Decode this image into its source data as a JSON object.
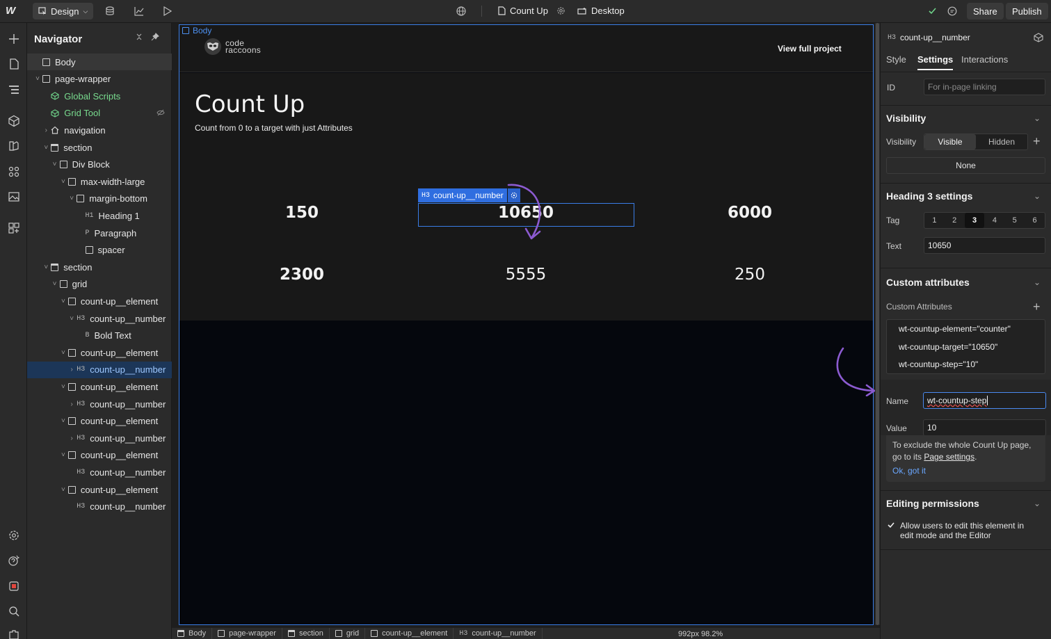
{
  "topbar": {
    "logo": "W",
    "mode": "Design",
    "page": "Count Up",
    "breakpoint": "Desktop",
    "share": "Share",
    "publish": "Publish"
  },
  "navigator": {
    "title": "Navigator",
    "items": [
      {
        "label": "Body",
        "kind": "el",
        "indent": 0,
        "caret": ""
      },
      {
        "label": "page-wrapper",
        "kind": "el",
        "indent": 0,
        "caret": "v"
      },
      {
        "label": "Global Scripts",
        "kind": "comp",
        "indent": 1,
        "caret": ""
      },
      {
        "label": "Grid Tool",
        "kind": "comp",
        "indent": 1,
        "caret": ""
      },
      {
        "label": "navigation",
        "kind": "home",
        "indent": 1,
        "caret": ">"
      },
      {
        "label": "section",
        "kind": "sec",
        "indent": 1,
        "caret": "v"
      },
      {
        "label": "Div Block",
        "kind": "el",
        "indent": 2,
        "caret": "v"
      },
      {
        "label": "max-width-large",
        "kind": "el",
        "indent": 3,
        "caret": "v"
      },
      {
        "label": "margin-bottom",
        "kind": "el",
        "indent": 4,
        "caret": "v"
      },
      {
        "label": "Heading 1",
        "kind": "tag",
        "tag": "H1",
        "indent": 5,
        "caret": ""
      },
      {
        "label": "Paragraph",
        "kind": "tag",
        "tag": "P",
        "indent": 5,
        "caret": ""
      },
      {
        "label": "spacer",
        "kind": "el",
        "indent": 5,
        "caret": ""
      },
      {
        "label": "section",
        "kind": "sec",
        "indent": 1,
        "caret": "v"
      },
      {
        "label": "grid",
        "kind": "el",
        "indent": 2,
        "caret": "v"
      },
      {
        "label": "count-up__element",
        "kind": "el",
        "indent": 3,
        "caret": "v"
      },
      {
        "label": "count-up__number",
        "kind": "tag",
        "tag": "H3",
        "indent": 4,
        "caret": "v"
      },
      {
        "label": "Bold Text",
        "kind": "tag",
        "tag": "B",
        "indent": 5,
        "caret": ""
      },
      {
        "label": "count-up__element",
        "kind": "el",
        "indent": 3,
        "caret": "v"
      },
      {
        "label": "count-up__number",
        "kind": "tag",
        "tag": "H3",
        "indent": 4,
        "caret": ">"
      },
      {
        "label": "count-up__element",
        "kind": "el",
        "indent": 3,
        "caret": "v"
      },
      {
        "label": "count-up__number",
        "kind": "tag",
        "tag": "H3",
        "indent": 4,
        "caret": ">"
      },
      {
        "label": "count-up__element",
        "kind": "el",
        "indent": 3,
        "caret": "v"
      },
      {
        "label": "count-up__number",
        "kind": "tag",
        "tag": "H3",
        "indent": 4,
        "caret": ">"
      },
      {
        "label": "count-up__element",
        "kind": "el",
        "indent": 3,
        "caret": "v"
      },
      {
        "label": "count-up__number",
        "kind": "tag",
        "tag": "H3",
        "indent": 4,
        "caret": ""
      },
      {
        "label": "count-up__element",
        "kind": "el",
        "indent": 3,
        "caret": "v"
      },
      {
        "label": "count-up__number",
        "kind": "tag",
        "tag": "H3",
        "indent": 4,
        "caret": ""
      }
    ],
    "selected_index": 18
  },
  "canvas": {
    "body_label": "Body",
    "logo_text_1": "code",
    "logo_text_2": "raccoons",
    "view_project": "View full project",
    "heading": "Count Up",
    "paragraph": "Count from 0 to a target with just Attributes",
    "selection_tag": "H3",
    "selection_label": "count-up__number",
    "numbers": [
      "150",
      "10650",
      "6000",
      "2300",
      "5555",
      "250"
    ]
  },
  "breadcrumb": [
    "Body",
    "page-wrapper",
    "section",
    "grid",
    "count-up__element",
    "count-up__number"
  ],
  "breadcrumb_tag": "H3",
  "size_readout": "992px 98.2%",
  "right_panel": {
    "element_tag": "H3",
    "element_name": "count-up__number",
    "tabs": [
      "Style",
      "Settings",
      "Interactions"
    ],
    "active_tab": "Settings",
    "id_label": "ID",
    "id_placeholder": "For in-page linking",
    "visibility_title": "Visibility",
    "visibility_label": "Visibility",
    "visibility_options": [
      "Visible",
      "Hidden"
    ],
    "visibility_none": "None",
    "heading_settings_title": "Heading 3 settings",
    "tag_label": "Tag",
    "tag_options": [
      "1",
      "2",
      "3",
      "4",
      "5",
      "6"
    ],
    "tag_selected": "3",
    "text_label": "Text",
    "text_value": "10650",
    "custom_attr_title": "Custom attributes",
    "custom_attr_sublabel": "Custom Attributes",
    "attributes": [
      "wt-countup-element=\"counter\"",
      "wt-countup-target=\"10650\"",
      "wt-countup-step=\"10\""
    ],
    "name_label": "Name",
    "name_value": "wt-countup-step",
    "value_label": "Value",
    "value_value": "10",
    "tip_line1": "To exclude the whole Count Up page,",
    "tip_line2_pre": "go to its ",
    "tip_link": "Page settings",
    "tip_line2_post": ".",
    "tip_ok": "Ok, got it",
    "permissions_title": "Editing permissions",
    "permissions_text": "Allow users to edit this element in edit mode and the Editor"
  },
  "colors": {
    "accent": "#3a7ee8",
    "arrow": "#8c5bd1",
    "panel": "#2b2b2b",
    "canvas": "#05070d"
  }
}
